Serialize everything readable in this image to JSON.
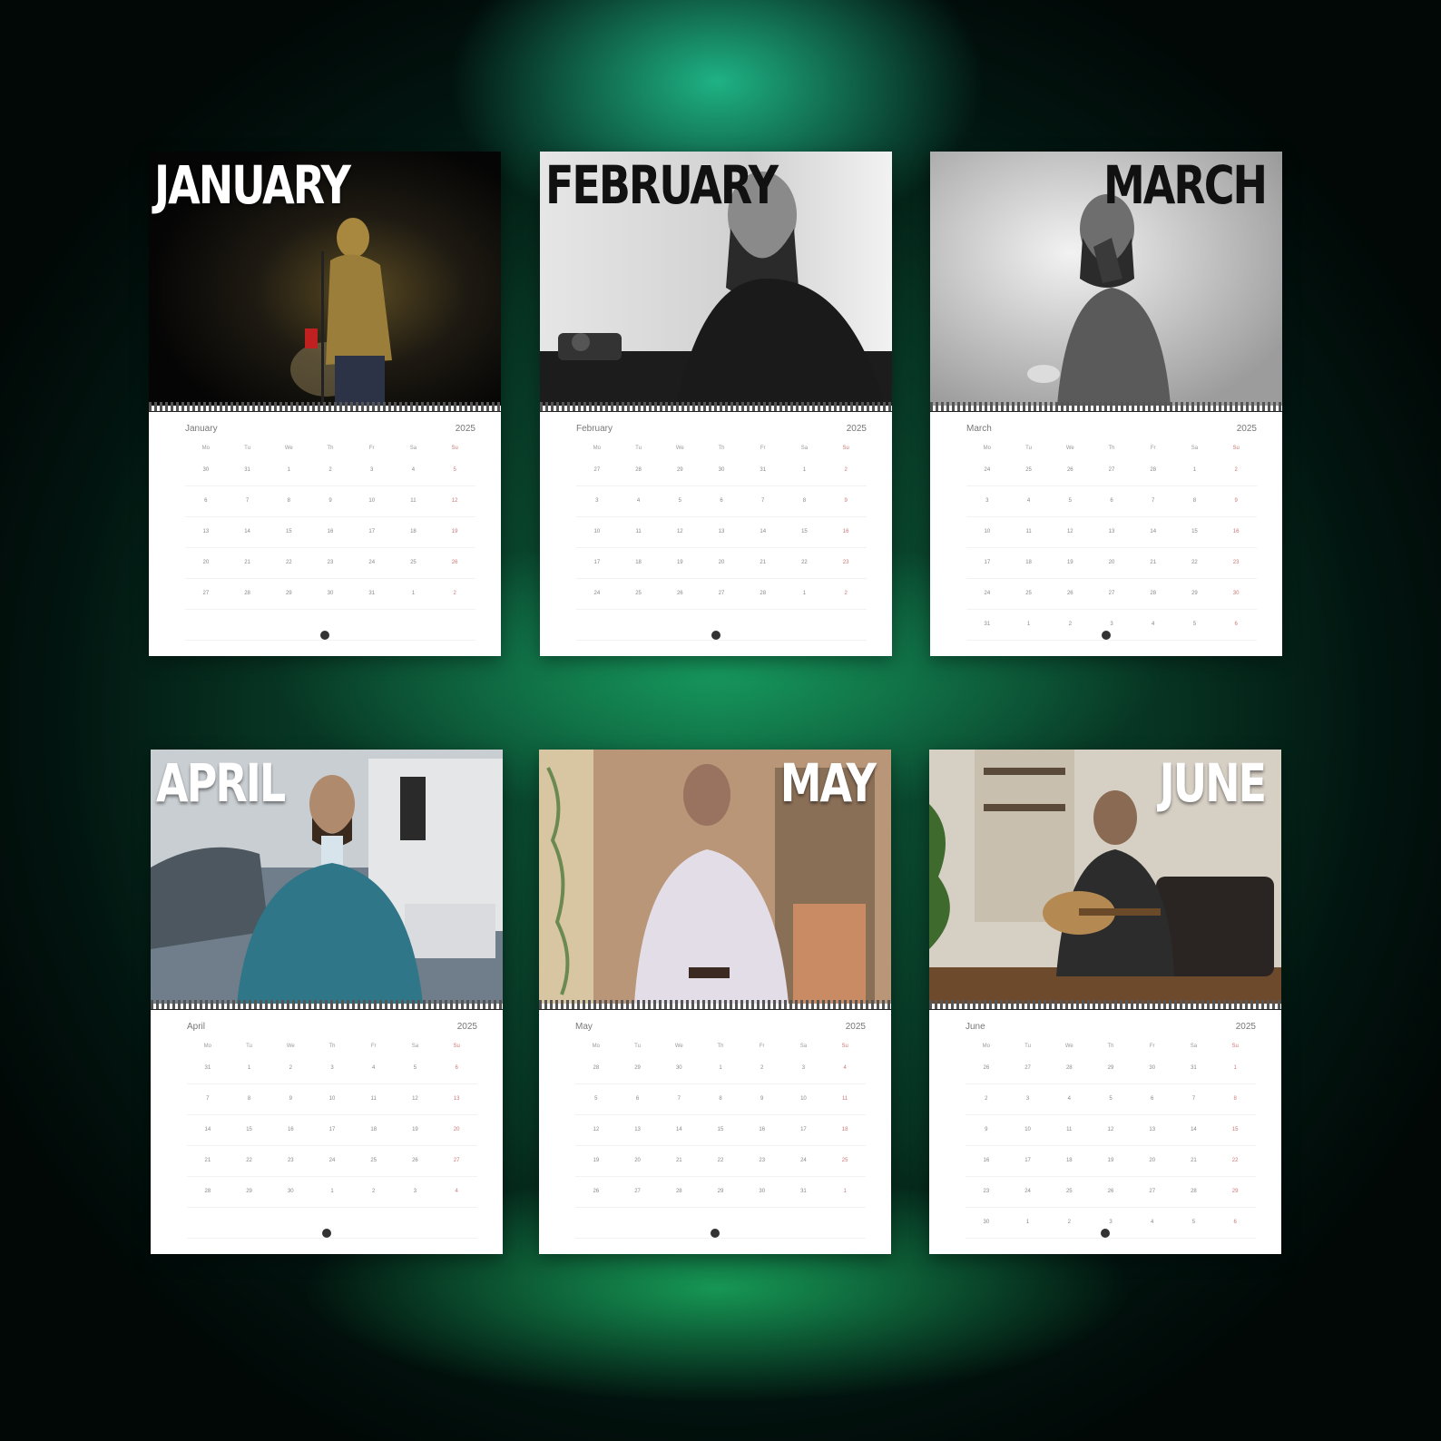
{
  "colors": {
    "background": "#07351f",
    "glow": "#1fd88a",
    "page": "#ffffff"
  },
  "year": "2025",
  "weekdays": [
    "Mo",
    "Tu",
    "We",
    "Th",
    "Fr",
    "Sa",
    "Su"
  ],
  "calendars": [
    {
      "title": "JANUARY",
      "label": "January",
      "weeks": [
        [
          "30",
          "31",
          "1",
          "2",
          "3",
          "4",
          "5"
        ],
        [
          "6",
          "7",
          "8",
          "9",
          "10",
          "11",
          "12"
        ],
        [
          "13",
          "14",
          "15",
          "16",
          "17",
          "18",
          "19"
        ],
        [
          "20",
          "21",
          "22",
          "23",
          "24",
          "25",
          "26"
        ],
        [
          "27",
          "28",
          "29",
          "30",
          "31",
          "1",
          "2"
        ],
        [
          "",
          "",
          "",
          "",
          "",
          "",
          ""
        ]
      ]
    },
    {
      "title": "FEBRUARY",
      "label": "February",
      "weeks": [
        [
          "27",
          "28",
          "29",
          "30",
          "31",
          "1",
          "2"
        ],
        [
          "3",
          "4",
          "5",
          "6",
          "7",
          "8",
          "9"
        ],
        [
          "10",
          "11",
          "12",
          "13",
          "14",
          "15",
          "16"
        ],
        [
          "17",
          "18",
          "19",
          "20",
          "21",
          "22",
          "23"
        ],
        [
          "24",
          "25",
          "26",
          "27",
          "28",
          "1",
          "2"
        ],
        [
          "",
          "",
          "",
          "",
          "",
          "",
          ""
        ]
      ]
    },
    {
      "title": "MARCH",
      "label": "March",
      "weeks": [
        [
          "24",
          "25",
          "26",
          "27",
          "28",
          "1",
          "2"
        ],
        [
          "3",
          "4",
          "5",
          "6",
          "7",
          "8",
          "9"
        ],
        [
          "10",
          "11",
          "12",
          "13",
          "14",
          "15",
          "16"
        ],
        [
          "17",
          "18",
          "19",
          "20",
          "21",
          "22",
          "23"
        ],
        [
          "24",
          "25",
          "26",
          "27",
          "28",
          "29",
          "30"
        ],
        [
          "31",
          "1",
          "2",
          "3",
          "4",
          "5",
          "6"
        ]
      ]
    },
    {
      "title": "APRIL",
      "label": "April",
      "weeks": [
        [
          "31",
          "1",
          "2",
          "3",
          "4",
          "5",
          "6"
        ],
        [
          "7",
          "8",
          "9",
          "10",
          "11",
          "12",
          "13"
        ],
        [
          "14",
          "15",
          "16",
          "17",
          "18",
          "19",
          "20"
        ],
        [
          "21",
          "22",
          "23",
          "24",
          "25",
          "26",
          "27"
        ],
        [
          "28",
          "29",
          "30",
          "1",
          "2",
          "3",
          "4"
        ],
        [
          "",
          "",
          "",
          "",
          "",
          "",
          ""
        ]
      ]
    },
    {
      "title": "MAY",
      "label": "May",
      "weeks": [
        [
          "28",
          "29",
          "30",
          "1",
          "2",
          "3",
          "4"
        ],
        [
          "5",
          "6",
          "7",
          "8",
          "9",
          "10",
          "11"
        ],
        [
          "12",
          "13",
          "14",
          "15",
          "16",
          "17",
          "18"
        ],
        [
          "19",
          "20",
          "21",
          "22",
          "23",
          "24",
          "25"
        ],
        [
          "26",
          "27",
          "28",
          "29",
          "30",
          "31",
          "1"
        ],
        [
          "",
          "",
          "",
          "",
          "",
          "",
          ""
        ]
      ]
    },
    {
      "title": "JUNE",
      "label": "June",
      "weeks": [
        [
          "26",
          "27",
          "28",
          "29",
          "30",
          "31",
          "1"
        ],
        [
          "2",
          "3",
          "4",
          "5",
          "6",
          "7",
          "8"
        ],
        [
          "9",
          "10",
          "11",
          "12",
          "13",
          "14",
          "15"
        ],
        [
          "16",
          "17",
          "18",
          "19",
          "20",
          "21",
          "22"
        ],
        [
          "23",
          "24",
          "25",
          "26",
          "27",
          "28",
          "29"
        ],
        [
          "30",
          "1",
          "2",
          "3",
          "4",
          "5",
          "6"
        ]
      ]
    }
  ]
}
